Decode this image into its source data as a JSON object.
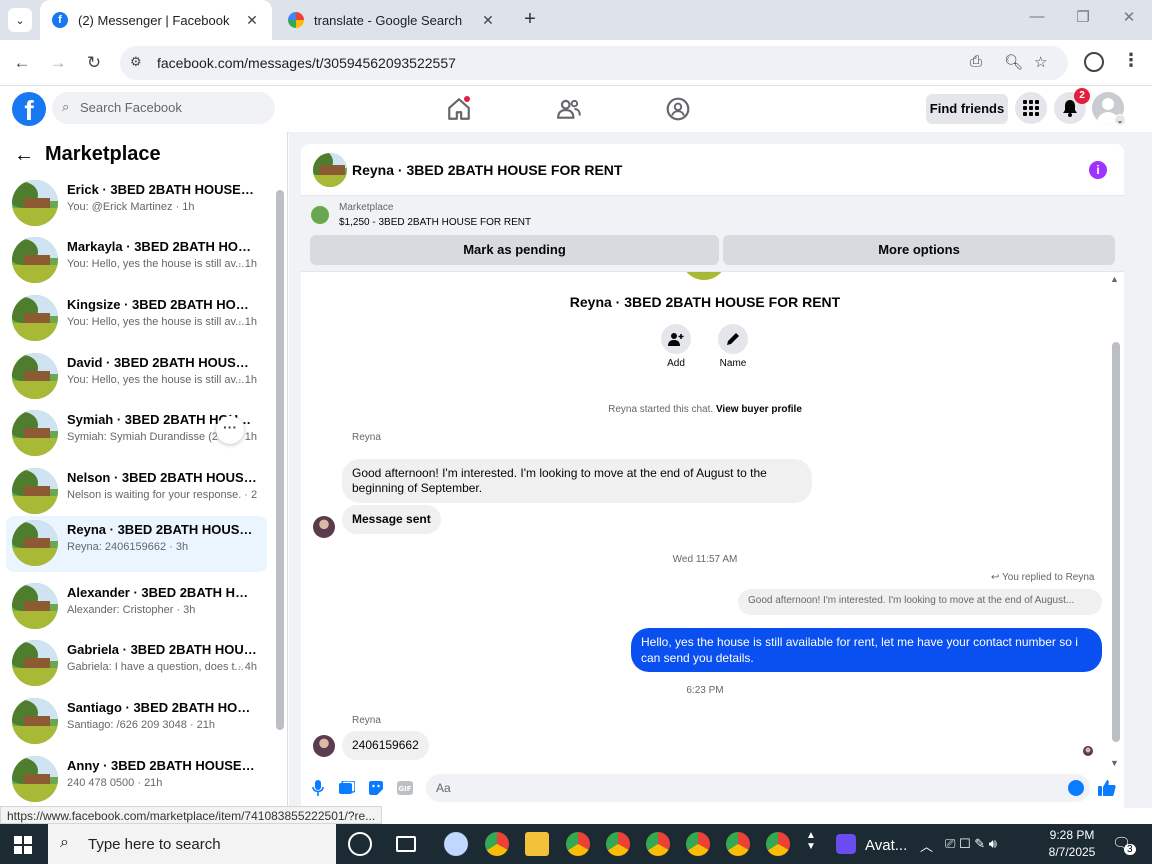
{
  "browser": {
    "tabs": [
      {
        "title": "(2) Messenger | Facebook",
        "active": true
      },
      {
        "title": "translate - Google Search",
        "active": false
      }
    ],
    "url": "facebook.com/messages/t/30594562093522557",
    "status_url": "https://www.facebook.com/marketplace/item/741083855222501/?re..."
  },
  "fb_header": {
    "search_placeholder": "Search Facebook",
    "find_friends": "Find friends",
    "notification_count": "2"
  },
  "sidebar": {
    "title": "Marketplace",
    "conversations": [
      {
        "name": "Erick · 3BED 2BATH HOUSE FOR...",
        "preview": "You: @Erick Martinez · 1h",
        "time": ""
      },
      {
        "name": "Markayla · 3BED 2BATH HOUSE ...",
        "preview": "You: Hello, yes the house is still av...",
        "time": "· 1h"
      },
      {
        "name": "Kingsize · 3BED 2BATH HOUSE ...",
        "preview": "You: Hello, yes the house is still av...",
        "time": "· 1h"
      },
      {
        "name": "David · 3BED 2BATH HOUSE FO...",
        "preview": "You: Hello, yes the house is still av...",
        "time": "· 1h"
      },
      {
        "name": "Symiah · 3BED 2BATH HOUSE F...",
        "preview": "Symiah: Symiah Durandisse (240)",
        "time": "· 1h"
      },
      {
        "name": "Nelson · 3BED 2BATH HOUSE F...",
        "preview": "Nelson is waiting for your response. · 2h",
        "time": ""
      },
      {
        "name": "Reyna · 3BED 2BATH HOUSE FO...",
        "preview": "Reyna: 2406159662 · 3h",
        "time": ""
      },
      {
        "name": "Alexander · 3BED 2BATH HOUS...",
        "preview": "Alexander: Cristopher · 3h",
        "time": ""
      },
      {
        "name": "Gabriela · 3BED 2BATH HOUSE ...",
        "preview": "Gabriela: I have a question, does t...",
        "time": "· 4h"
      },
      {
        "name": "Santiago · 3BED 2BATH HOUSE ...",
        "preview": "Santiago: /626 209 3048 · 21h",
        "time": ""
      },
      {
        "name": "Anny · 3BED 2BATH HOUSE FO...",
        "preview": "240 478 0500 · 21h",
        "time": ""
      }
    ]
  },
  "chat": {
    "title": "Reyna · 3BED 2BATH HOUSE FOR RENT",
    "marketplace_label": "Marketplace",
    "listing": "$1,250 - 3BED 2BATH HOUSE FOR RENT",
    "mark_pending": "Mark as pending",
    "more_options": "More options",
    "intro_name": "Reyna · 3BED 2BATH HOUSE FOR RENT",
    "action_add": "Add",
    "action_name": "Name",
    "started_text": "Reyna started this chat.",
    "view_profile": "View buyer profile",
    "sender1": "Reyna",
    "msg1": "Good afternoon! I'm interested. I'm looking to move at the end of August to the beginning of September.",
    "msg2": "Message sent",
    "ts1": "Wed 11:57 AM",
    "replied_to": "You replied to Reyna",
    "quoted": "Good afternoon! I'm interested. I'm looking to move at the end of August...",
    "msg3": "Hello, yes the house is still available for rent, let me have your contact number so i can send you details.",
    "ts2": "6:23 PM",
    "sender2": "Reyna",
    "msg4": "2406159662",
    "composer_placeholder": "Aa"
  },
  "taskbar": {
    "search_placeholder": "Type here to search",
    "app_label": "Avat...",
    "time": "9:28 PM",
    "date": "8/7/2025",
    "notif": "3"
  }
}
